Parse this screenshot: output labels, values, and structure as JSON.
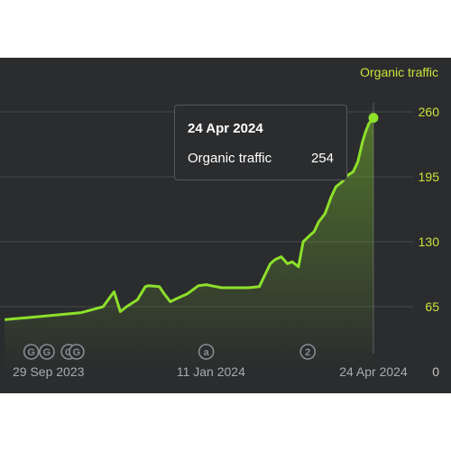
{
  "chart_data": {
    "type": "area",
    "series": [
      {
        "name": "Organic traffic",
        "color": "#8de02b"
      }
    ],
    "y_ticks": [
      "0",
      "65",
      "130",
      "195",
      "260"
    ],
    "ylim": [
      0,
      280
    ],
    "x_ticks": [
      "29 Sep 2023",
      "11 Jan 2024",
      "24 Apr 2024"
    ],
    "x": [
      "2023-09-01",
      "2023-09-08",
      "2023-09-15",
      "2023-09-22",
      "2023-09-29",
      "2023-10-06",
      "2023-10-13",
      "2023-10-20",
      "2023-10-27",
      "2023-11-03",
      "2023-11-10",
      "2023-11-14",
      "2023-11-18",
      "2023-11-25",
      "2023-11-30",
      "2023-12-02",
      "2023-12-09",
      "2023-12-12",
      "2023-12-16",
      "2023-12-20",
      "2023-12-27",
      "2024-01-03",
      "2024-01-08",
      "2024-01-11",
      "2024-01-18",
      "2024-01-21",
      "2024-01-28",
      "2024-02-04",
      "2024-02-11",
      "2024-02-14",
      "2024-02-18",
      "2024-02-21",
      "2024-02-25",
      "2024-02-29",
      "2024-03-03",
      "2024-03-07",
      "2024-03-10",
      "2024-03-14",
      "2024-03-17",
      "2024-03-20",
      "2024-03-24",
      "2024-03-28",
      "2024-03-31",
      "2024-04-04",
      "2024-04-07",
      "2024-04-11",
      "2024-04-14",
      "2024-04-17",
      "2024-04-19",
      "2024-04-21",
      "2024-04-22",
      "2024-04-23",
      "2024-04-24"
    ],
    "values": [
      52,
      53,
      54,
      55,
      56,
      57,
      58,
      59,
      62,
      65,
      80,
      60,
      65,
      72,
      85,
      86,
      85,
      78,
      70,
      73,
      78,
      86,
      87,
      86,
      84,
      84,
      84,
      84,
      85,
      95,
      108,
      112,
      115,
      108,
      110,
      105,
      130,
      136,
      140,
      150,
      158,
      175,
      185,
      190,
      196,
      200,
      210,
      230,
      240,
      248,
      250,
      252,
      254
    ],
    "annotations": [
      {
        "date": "2023-09-18",
        "label": "G"
      },
      {
        "date": "2023-09-28",
        "label": "G"
      },
      {
        "date": "2023-10-12",
        "label": "G"
      },
      {
        "date": "2023-10-17",
        "label": "G"
      },
      {
        "date": "2024-01-08",
        "label": "a"
      },
      {
        "date": "2024-03-13",
        "label": "2"
      }
    ],
    "tooltip": {
      "date": "24 Apr 2024",
      "series": "Organic traffic",
      "value": "254"
    },
    "grid": true,
    "legend": "top-right"
  }
}
